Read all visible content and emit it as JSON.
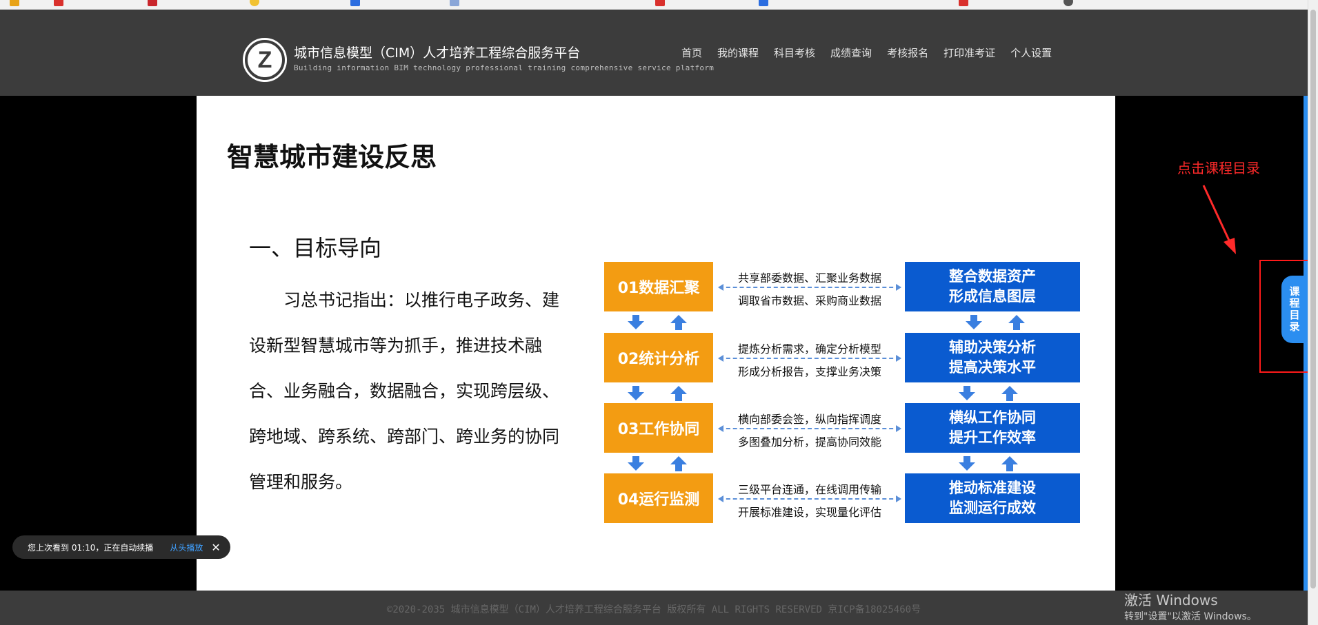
{
  "header": {
    "logo_letter": "Z",
    "title": "城市信息模型（CIM）人才培养工程综合服务平台",
    "subtitle": "Building information BIM technology professional training comprehensive service platform",
    "nav": [
      "首页",
      "我的课程",
      "科目考核",
      "成绩查询",
      "考核报名",
      "打印准考证",
      "个人设置"
    ]
  },
  "slide": {
    "title": "智慧城市建设反思",
    "section": "一、目标导向",
    "paragraph": "习总书记指出：以推行电子政务、建设新型智慧城市等为抓手，推进技术融合、业务融合，数据融合，实现跨层级、跨地域、跨系统、跨部门、跨业务的协同管理和服务。",
    "rows": [
      {
        "label": "01数据汇聚",
        "line1": "共享部委数据、汇聚业务数据",
        "line2": "调取省市数据、采购商业数据",
        "result1": "整合数据资产",
        "result2": "形成信息图层"
      },
      {
        "label": "02统计分析",
        "line1": "提炼分析需求，确定分析模型",
        "line2": "形成分析报告，支撑业务决策",
        "result1": "辅助决策分析",
        "result2": "提高决策水平"
      },
      {
        "label": "03工作协同",
        "line1": "横向部委会签，纵向指挥调度",
        "line2": "多图叠加分析，提高协同效能",
        "result1": "横纵工作协同",
        "result2": "提升工作效率"
      },
      {
        "label": "04运行监测",
        "line1": "三级平台连通，在线调用传输",
        "line2": "开展标准建设，实现量化评估",
        "result1": "推动标准建设",
        "result2": "监测运行成效"
      }
    ]
  },
  "resume": {
    "text": "您上次看到 01:10，正在自动续播",
    "replay": "从头播放",
    "close": "✕"
  },
  "annotation": "点击课程目录",
  "catalog_tab": "课程目录",
  "footer": "©2020-2035 城市信息模型（CIM）人才培养工程综合服务平台 版权所有 ALL RIGHTS RESERVED 京ICP备18025460号",
  "watermark": {
    "line1": "激活 Windows",
    "line2": "转到\"设置\"以激活 Windows。"
  },
  "colors": {
    "header": "#3c3c3c",
    "orange": "#f39c12",
    "blue": "#0a5bd0",
    "tab": "#2b8ef0",
    "annotation": "#ff2a2a"
  }
}
